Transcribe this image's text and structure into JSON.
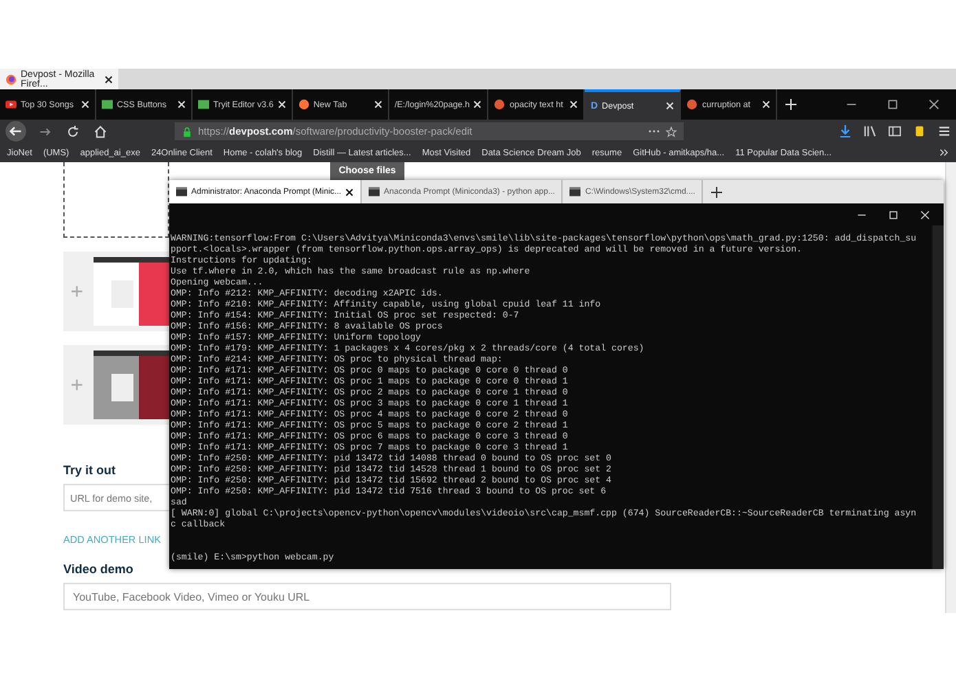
{
  "window": {
    "title": "Devpost - Mozilla Firef..."
  },
  "tabs": [
    {
      "label": "Top 30 Songs",
      "selected": false
    },
    {
      "label": "CSS Buttons",
      "selected": false
    },
    {
      "label": "Tryit Editor v3.6",
      "selected": false
    },
    {
      "label": "New Tab",
      "selected": false
    },
    {
      "label": "/E:/login%20page.h",
      "selected": false
    },
    {
      "label": "opacity text ht",
      "selected": false
    },
    {
      "label": "Devpost",
      "selected": true,
      "icon_letter": "D"
    },
    {
      "label": "curruption at",
      "selected": false
    }
  ],
  "url": {
    "prefix": "https://",
    "domain": "devpost.com",
    "path": "/software/productivity-booster-pack/edit"
  },
  "bookmarks": [
    "JioNet",
    "(UMS)",
    "applied_ai_exe",
    "24Online Client",
    "Home - colah's blog",
    "Distill — Latest articles...",
    "Most Visited",
    "Data Science Dream Job",
    "resume",
    "GitHub - amitkaps/ha...",
    "11 Popular Data Scien..."
  ],
  "page": {
    "upload_button": "Choose files",
    "try_it_out": {
      "label": "Try it out",
      "placeholder": "URL for demo site,"
    },
    "add_link": "ADD ANOTHER LINK",
    "video_demo": {
      "label": "Video demo",
      "placeholder": "YouTube, Facebook Video, Vimeo or Youku URL"
    }
  },
  "terminal": {
    "tabs": [
      {
        "label": "Administrator: Anaconda Prompt (Minic...",
        "selected": true
      },
      {
        "label": "Anaconda Prompt (Miniconda3) - python  app...",
        "selected": false
      },
      {
        "label": "C:\\Windows\\System32\\cmd....",
        "selected": false
      }
    ],
    "lines": [
      "WARNING:tensorflow:From C:\\Users\\Advitya\\Miniconda3\\envs\\smile\\lib\\site-packages\\tensorflow\\python\\ops\\math_grad.py:1250: add_dispatch_su",
      "pport.<locals>.wrapper (from tensorflow.python.ops.array_ops) is deprecated and will be removed in a future version.",
      "Instructions for updating:",
      "Use tf.where in 2.0, which has the same broadcast rule as np.where",
      "Opening webcam...",
      "OMP: Info #212: KMP_AFFINITY: decoding x2APIC ids.",
      "OMP: Info #210: KMP_AFFINITY: Affinity capable, using global cpuid leaf 11 info",
      "OMP: Info #154: KMP_AFFINITY: Initial OS proc set respected: 0-7",
      "OMP: Info #156: KMP_AFFINITY: 8 available OS procs",
      "OMP: Info #157: KMP_AFFINITY: Uniform topology",
      "OMP: Info #179: KMP_AFFINITY: 1 packages x 4 cores/pkg x 2 threads/core (4 total cores)",
      "OMP: Info #214: KMP_AFFINITY: OS proc to physical thread map:",
      "OMP: Info #171: KMP_AFFINITY: OS proc 0 maps to package 0 core 0 thread 0",
      "OMP: Info #171: KMP_AFFINITY: OS proc 1 maps to package 0 core 0 thread 1",
      "OMP: Info #171: KMP_AFFINITY: OS proc 2 maps to package 0 core 1 thread 0",
      "OMP: Info #171: KMP_AFFINITY: OS proc 3 maps to package 0 core 1 thread 1",
      "OMP: Info #171: KMP_AFFINITY: OS proc 4 maps to package 0 core 2 thread 0",
      "OMP: Info #171: KMP_AFFINITY: OS proc 5 maps to package 0 core 2 thread 1",
      "OMP: Info #171: KMP_AFFINITY: OS proc 6 maps to package 0 core 3 thread 0",
      "OMP: Info #171: KMP_AFFINITY: OS proc 7 maps to package 0 core 3 thread 1",
      "OMP: Info #250: KMP_AFFINITY: pid 13472 tid 14088 thread 0 bound to OS proc set 0",
      "OMP: Info #250: KMP_AFFINITY: pid 13472 tid 14528 thread 1 bound to OS proc set 2",
      "OMP: Info #250: KMP_AFFINITY: pid 13472 tid 15692 thread 2 bound to OS proc set 4",
      "OMP: Info #250: KMP_AFFINITY: pid 13472 tid 7516 thread 3 bound to OS proc set 6",
      "sad",
      "[ WARN:0] global C:\\projects\\opencv-python\\opencv\\modules\\videoio\\src\\cap_msmf.cpp (674) SourceReaderCB::~SourceReaderCB terminating asyn",
      "c callback"
    ],
    "prompt": "(smile) E:\\sm>python webcam.py"
  }
}
